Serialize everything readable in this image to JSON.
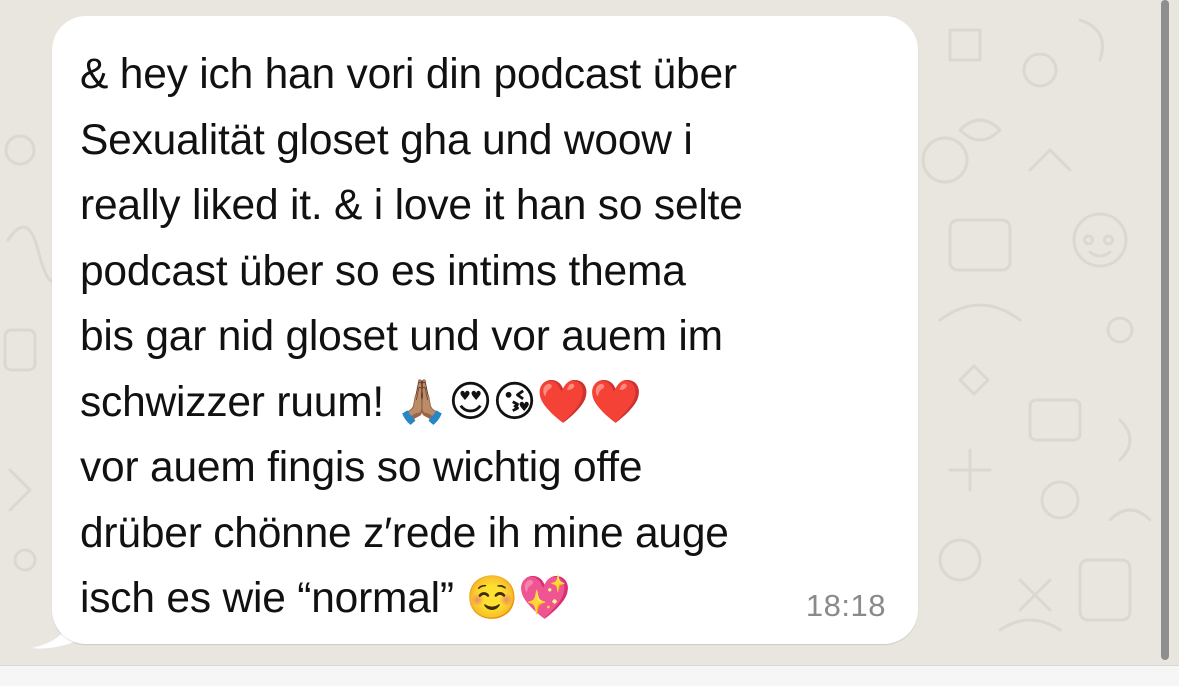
{
  "chat": {
    "message": {
      "text": "& hey ich han vori din podcast über\nSexualität gloset gha und woow i\nreally liked it. & i love it han so selte\npodcast über so es intims thema\nbis gar nid gloset und vor auem im\nschwizzer ruum! 🙏🏽😍😘❤️❤️\nvor auem fingis so wichtig offe\ndrüber chönne z′rede ih mine auge\nisch es wie “normal” ☺️💖",
      "time": "18:18"
    }
  },
  "colors": {
    "wallpaper": "#e9e6df",
    "bubble": "#ffffff",
    "text": "#111111",
    "timestamp": "#8a8a8a",
    "scrollbar": "#8e8e8e"
  }
}
